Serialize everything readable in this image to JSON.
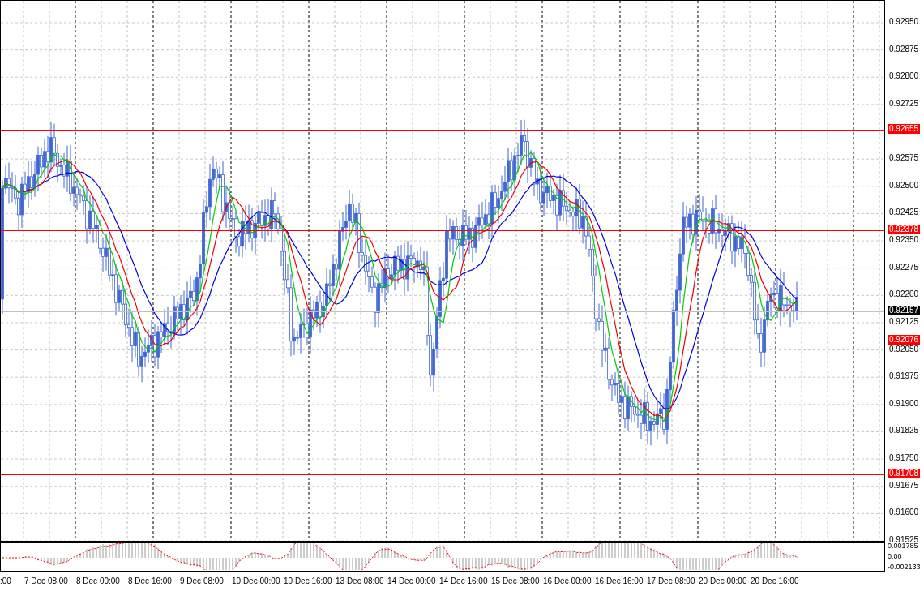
{
  "price_axis": {
    "ticks": [
      "0.92950",
      "0.92875",
      "0.92800",
      "0.92725",
      "0.92575",
      "0.92500",
      "0.92425",
      "0.92350",
      "0.92275",
      "0.92200",
      "0.92125",
      "0.92050",
      "0.91975",
      "0.91900",
      "0.91825",
      "0.91750",
      "0.91675",
      "0.91600",
      "0.91525"
    ]
  },
  "levels": [
    {
      "kind": "line",
      "label": "0.92655",
      "color": "#ff0000"
    },
    {
      "kind": "line",
      "label": "0.92378",
      "color": "#ff0000"
    },
    {
      "kind": "current",
      "label": "0.92157",
      "color": "#000000"
    },
    {
      "kind": "line",
      "label": "0.92076",
      "color": "#ff0000"
    },
    {
      "kind": "line",
      "label": "0.91708",
      "color": "#ff0000"
    }
  ],
  "indicator_axis": [
    "0.001785",
    "0.00",
    "-0.002133"
  ],
  "time_axis": [
    ":00",
    "7 Dec 08:00",
    "8 Dec 00:00",
    "8 Dec 16:00",
    "9 Dec 08:00",
    "10 Dec 00:00",
    "10 Dec 16:00",
    "13 Dec 08:00",
    "14 Dec 00:00",
    "14 Dec 16:00",
    "15 Dec 08:00",
    "16 Dec 00:00",
    "16 Dec 16:00",
    "17 Dec 08:00",
    "20 Dec 00:00",
    "20 Dec 16:00"
  ]
}
